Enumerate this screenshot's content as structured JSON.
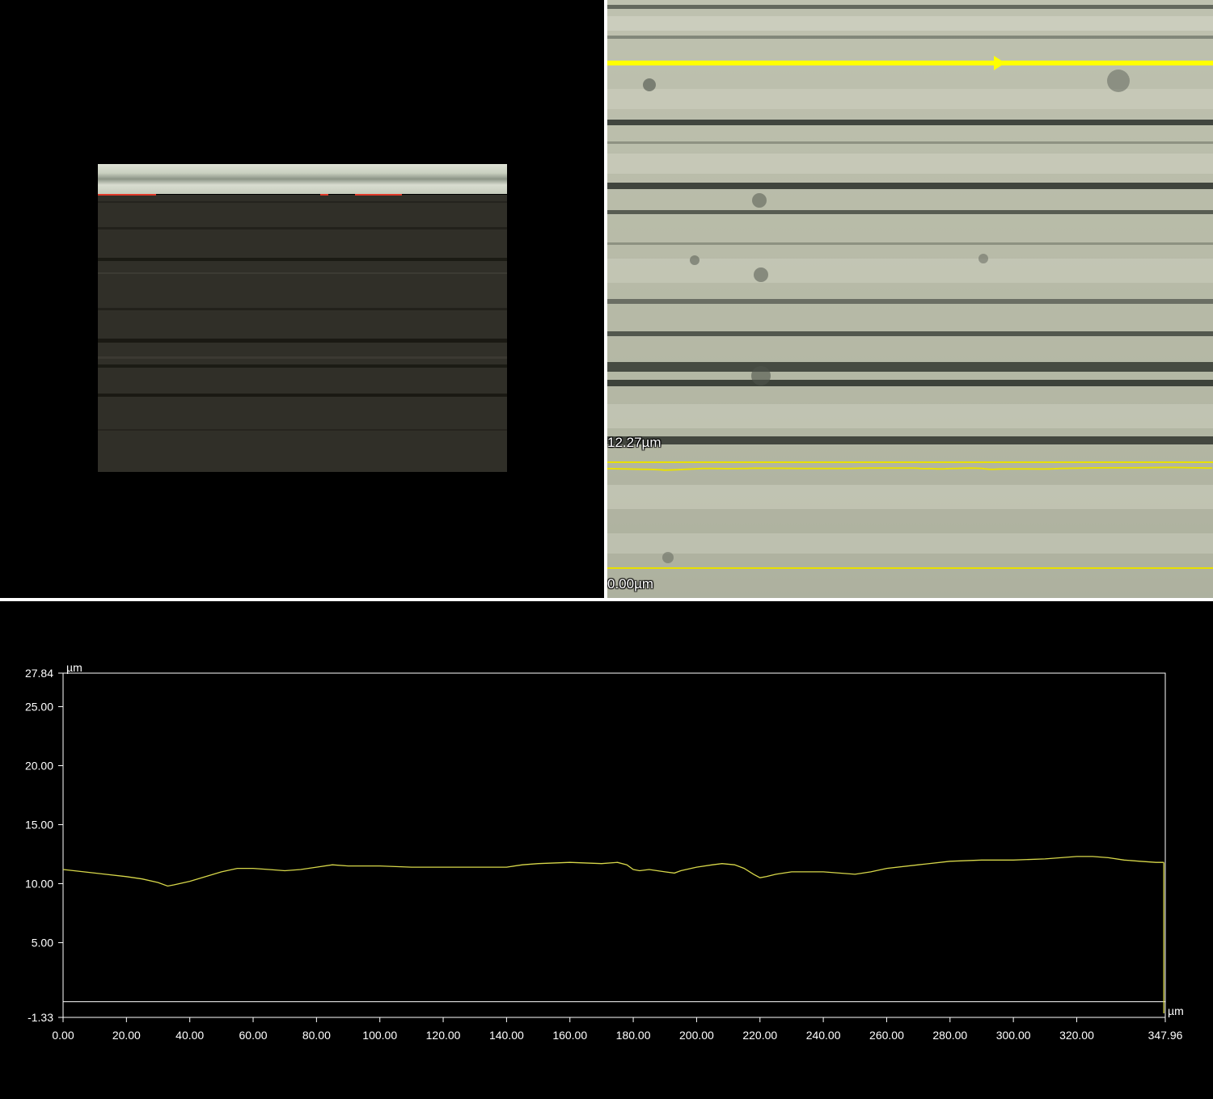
{
  "overview": {
    "description_color": "#302f28"
  },
  "zoom": {
    "upper_label": "12.27µm",
    "lower_label": "0.00µm",
    "scan_line_color": "#ffff00",
    "profile_overlay_color": "#e8e000"
  },
  "chart_data": {
    "type": "line",
    "title": "",
    "xlabel": "µm",
    "ylabel": "µm",
    "xlim": [
      0,
      347.96
    ],
    "ylim": [
      -1.33,
      27.84
    ],
    "x_ticks": [
      "0.00",
      "20.00",
      "40.00",
      "60.00",
      "80.00",
      "100.00",
      "120.00",
      "140.00",
      "160.00",
      "180.00",
      "200.00",
      "220.00",
      "240.00",
      "260.00",
      "280.00",
      "300.00",
      "320.00",
      "347.96"
    ],
    "y_ticks": [
      "27.84",
      "25.00",
      "20.00",
      "15.00",
      "10.00",
      "5.00",
      "-1.33"
    ],
    "grid": false,
    "line_color": "#d8d84a",
    "baseline": 0.0,
    "series": [
      {
        "x": [
          0,
          10,
          20,
          25,
          30,
          33,
          35,
          40,
          45,
          50,
          55,
          60,
          65,
          70,
          75,
          80,
          85,
          90,
          100,
          110,
          120,
          130,
          140,
          145,
          150,
          160,
          170,
          175,
          178,
          180,
          182,
          185,
          190,
          193,
          195,
          200,
          205,
          208,
          212,
          215,
          218,
          220,
          222,
          225,
          230,
          240,
          250,
          255,
          260,
          270,
          280,
          290,
          300,
          310,
          320,
          325,
          330,
          335,
          340,
          345,
          347.5
        ],
        "y": [
          11.2,
          10.9,
          10.6,
          10.4,
          10.1,
          9.8,
          9.9,
          10.2,
          10.6,
          11.0,
          11.3,
          11.3,
          11.2,
          11.1,
          11.2,
          11.4,
          11.6,
          11.5,
          11.5,
          11.4,
          11.4,
          11.4,
          11.4,
          11.6,
          11.7,
          11.8,
          11.7,
          11.8,
          11.6,
          11.2,
          11.1,
          11.2,
          11.0,
          10.9,
          11.1,
          11.4,
          11.6,
          11.7,
          11.6,
          11.3,
          10.8,
          10.5,
          10.6,
          10.8,
          11.0,
          11.0,
          10.8,
          11.0,
          11.3,
          11.6,
          11.9,
          12.0,
          12.0,
          12.1,
          12.3,
          12.3,
          12.2,
          12.0,
          11.9,
          11.8,
          11.8
        ]
      }
    ]
  }
}
